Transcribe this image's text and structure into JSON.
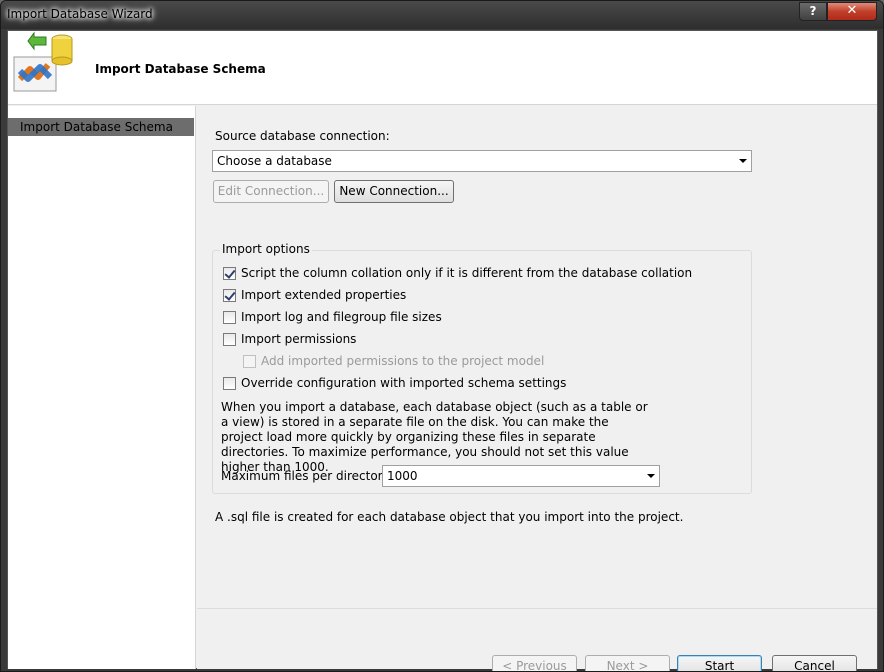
{
  "window": {
    "title": "Import Database Wizard",
    "help_label": "?",
    "close_label": "✕"
  },
  "header": {
    "title": "Import Database Schema"
  },
  "nav": {
    "items": [
      {
        "label": "Import Database Schema",
        "selected": true
      }
    ]
  },
  "source": {
    "label": "Source database connection:",
    "selected": "Choose a database",
    "edit_button": "Edit Connection...",
    "new_button": "New Connection..."
  },
  "options": {
    "title": "Import options",
    "items": [
      {
        "label": "Script the column collation only if it is different from the database collation",
        "checked": true,
        "enabled": true
      },
      {
        "label": "Import extended properties",
        "checked": true,
        "enabled": true
      },
      {
        "label": "Import log and filegroup file sizes",
        "checked": false,
        "enabled": true
      },
      {
        "label": "Import permissions",
        "checked": false,
        "enabled": true
      },
      {
        "label": "Add imported permissions to the project model",
        "checked": false,
        "enabled": false
      },
      {
        "label": "Override configuration with imported schema settings",
        "checked": false,
        "enabled": true
      }
    ],
    "description": "When you import a database, each database object (such as a table or a view) is stored in a separate file on the disk. You can make the project load more quickly by organizing these files in separate directories. To maximize performance, you should not set this value higher than 1000.",
    "max_files_label": "Maximum files per directory:",
    "max_files_value": "1000"
  },
  "note": "A .sql file is created for each database object that you import into the project.",
  "buttons": {
    "previous": "< Previous",
    "next": "Next >",
    "start": "Start",
    "cancel": "Cancel"
  },
  "colors": {
    "accent": "#3c7fb1",
    "nav_selected": "#6d6d6d"
  }
}
